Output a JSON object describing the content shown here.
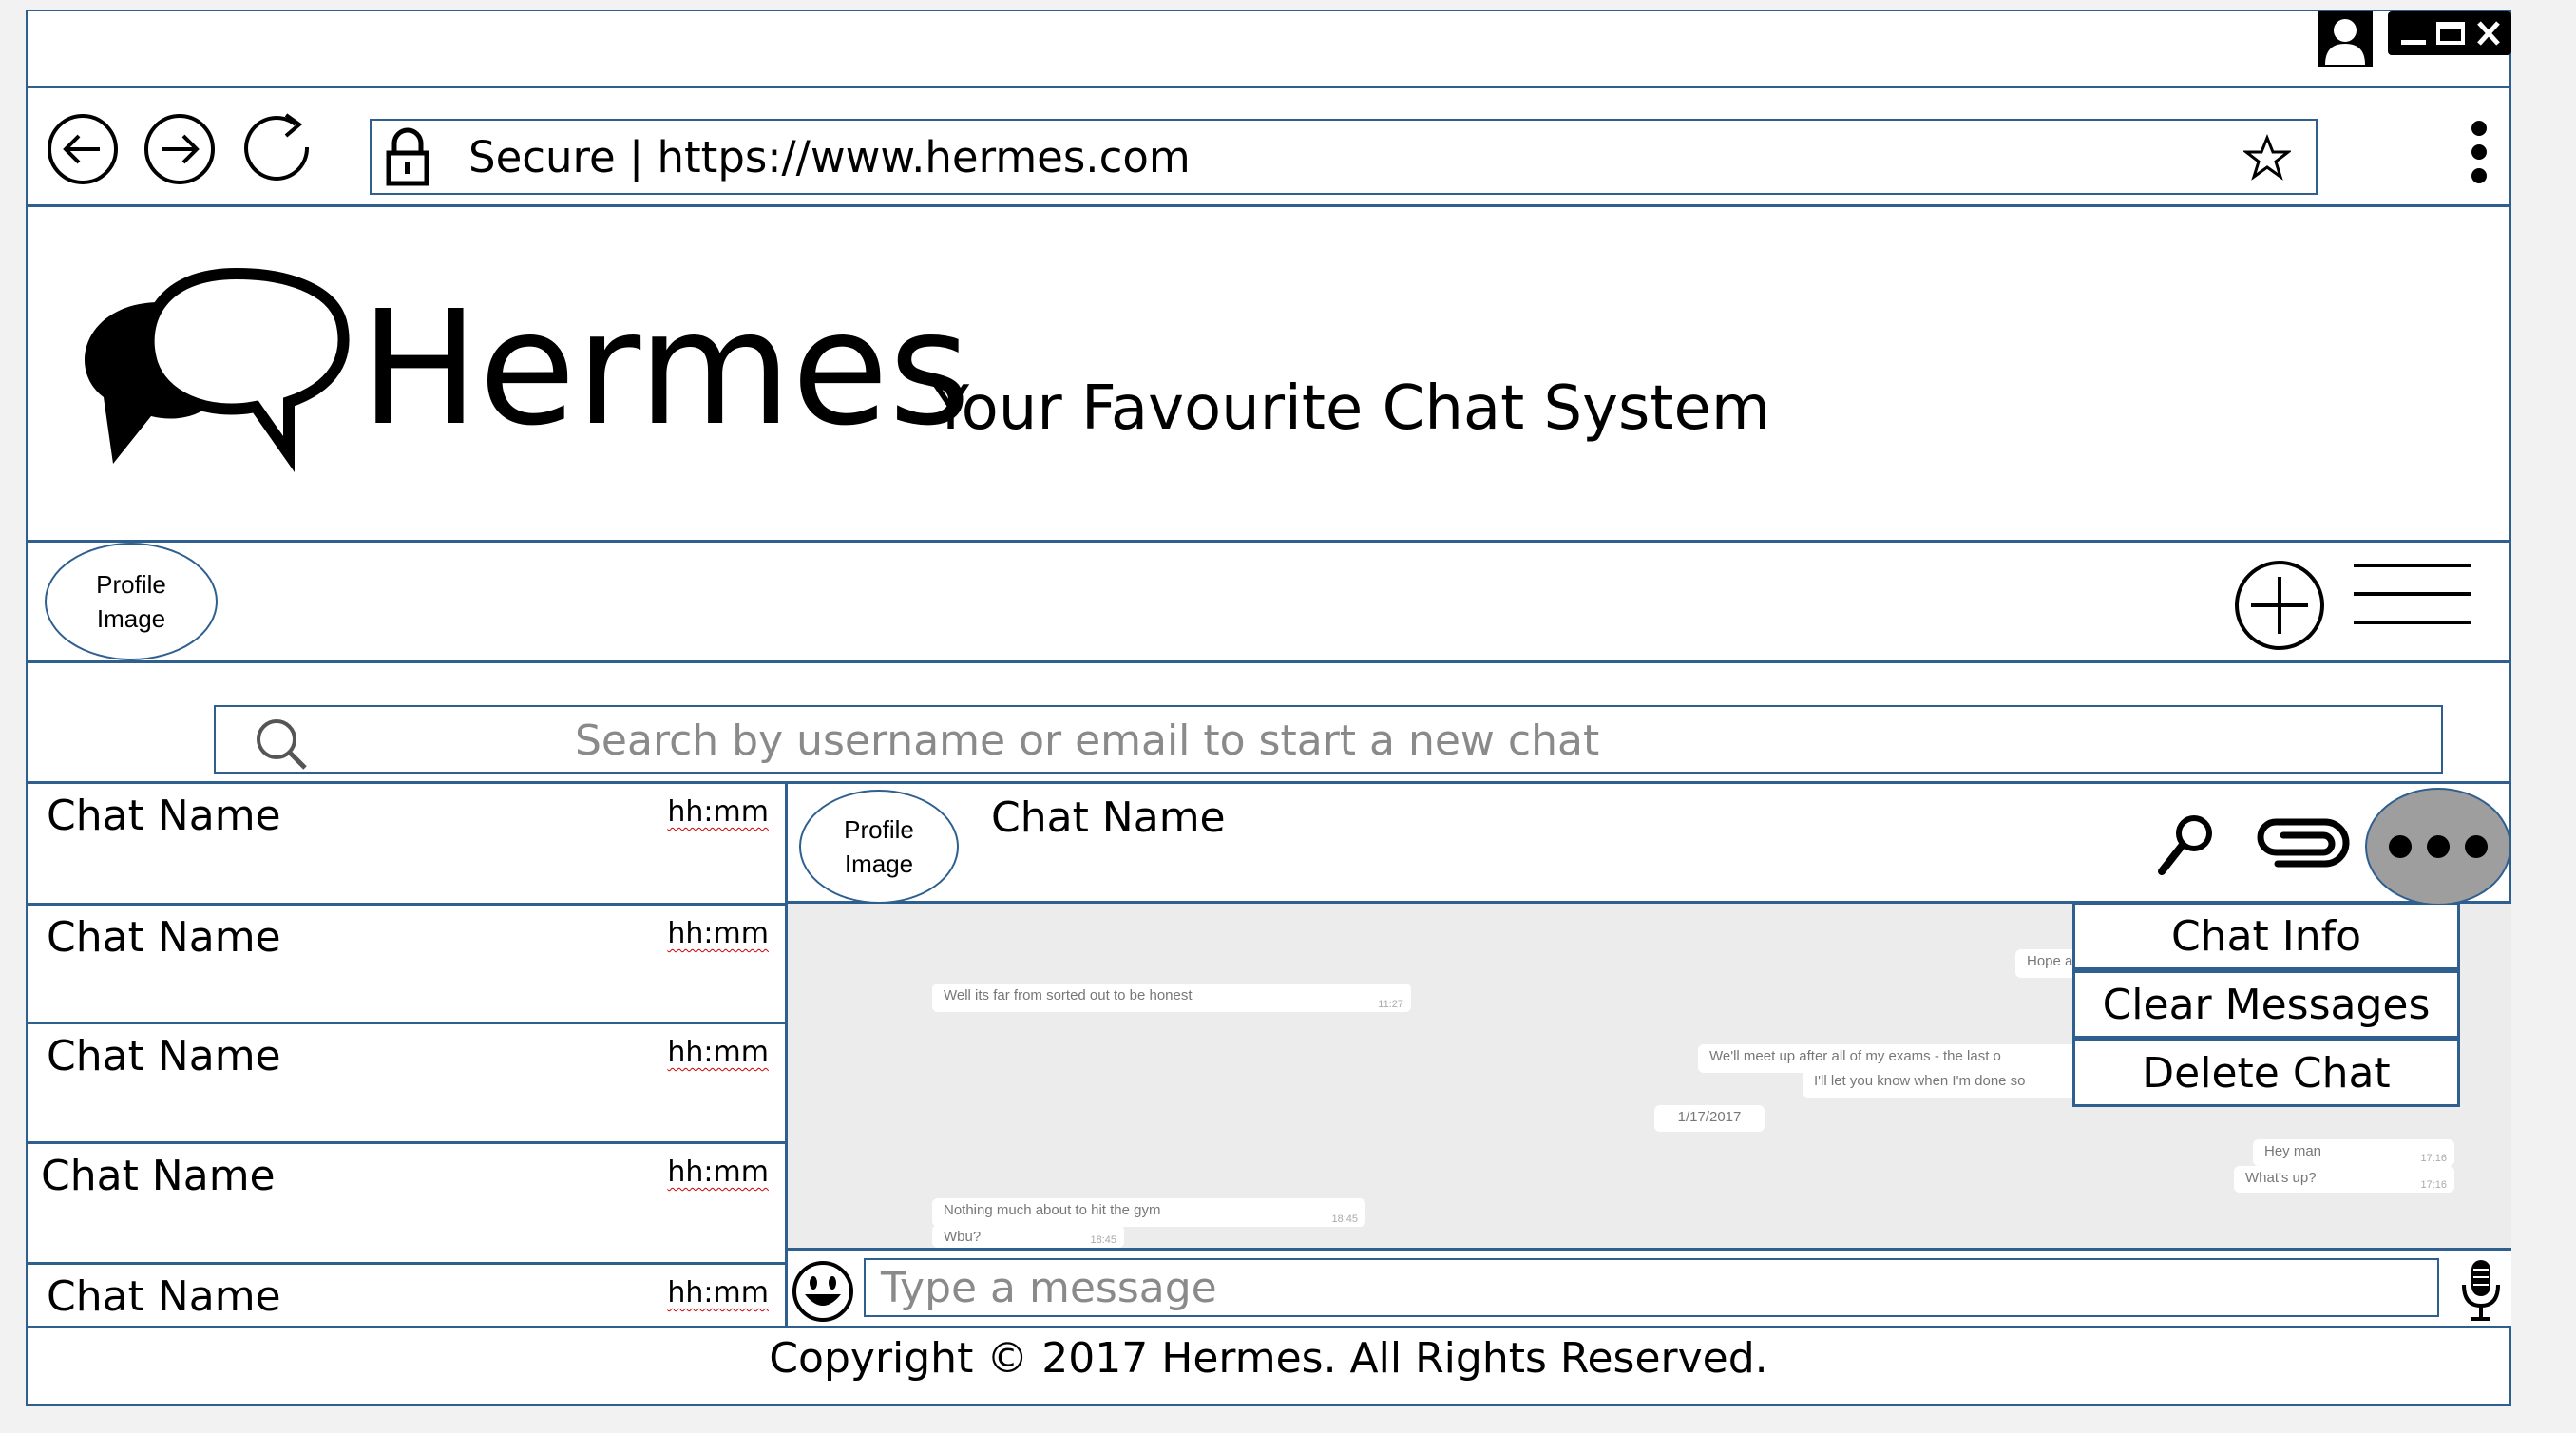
{
  "window": {
    "controls": [
      "user-icon",
      "minimize-icon",
      "maximize-icon",
      "close-icon"
    ]
  },
  "browser": {
    "address_prefix": "Secure",
    "separator": "|",
    "url": "https://www.hermes.com"
  },
  "header": {
    "app_name": "Hermes",
    "tagline": "Your Favourite Chat System"
  },
  "user_bar": {
    "profile_label_line1": "Profile",
    "profile_label_line2": "Image"
  },
  "search": {
    "placeholder": "Search by username or email to start a new chat"
  },
  "chat_list": [
    {
      "name": "Chat Name",
      "time": "hh:mm"
    },
    {
      "name": "Chat Name",
      "time": "hh:mm"
    },
    {
      "name": "Chat Name",
      "time": "hh:mm"
    },
    {
      "name": "Chat Name",
      "time": "hh:mm"
    },
    {
      "name": "Chat Name",
      "time": "hh:mm"
    }
  ],
  "conversation": {
    "profile_label_line1": "Profile",
    "profile_label_line2": "Image",
    "chat_name": "Chat Name",
    "menu": [
      "Chat Info",
      "Clear Messages",
      "Delete Chat"
    ],
    "messages": [
      {
        "text": "Hope a",
        "time": ""
      },
      {
        "text": "Well its far from sorted out to be honest",
        "time": "11:27"
      },
      {
        "text": "We'll meet up after all of my exams - the last o",
        "time": ""
      },
      {
        "text": "I'll let you know when I'm done so",
        "time": ""
      },
      {
        "text": "1/17/2017",
        "time": ""
      },
      {
        "text": "Hey man",
        "time": "17:16"
      },
      {
        "text": "What's up?",
        "time": "17:16"
      },
      {
        "text": "Nothing much about to hit the gym",
        "time": "18:45"
      },
      {
        "text": "Wbu?",
        "time": "18:45"
      }
    ],
    "input_placeholder": "Type a message"
  },
  "footer": {
    "copyright": "Copyright © 2017 Hermes. All Rights Reserved."
  },
  "colors": {
    "border": "#2f5f8f",
    "chat_bg": "#ececec",
    "more_button": "#9e9e9e"
  }
}
